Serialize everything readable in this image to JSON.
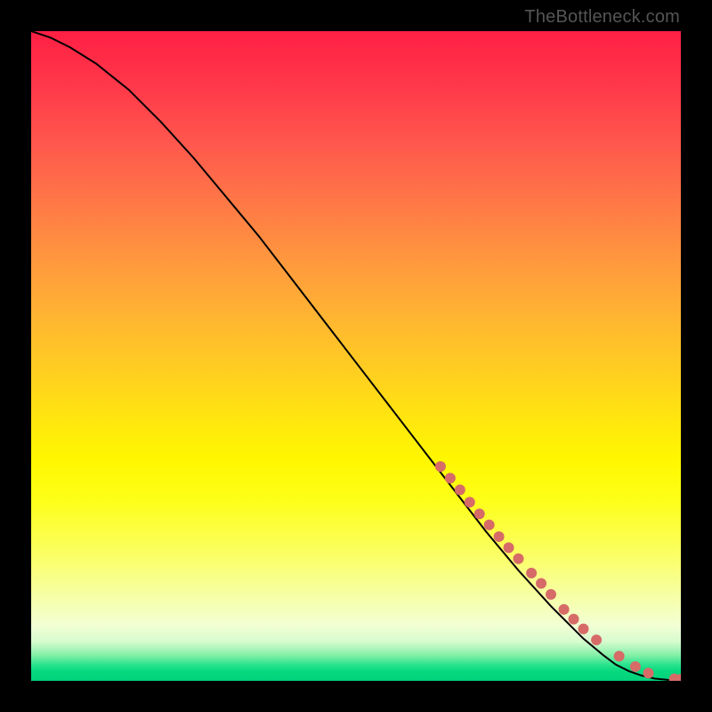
{
  "attribution": "TheBottleneck.com",
  "chart_data": {
    "type": "line",
    "title": "",
    "xlabel": "",
    "ylabel": "",
    "xlim": [
      0,
      100
    ],
    "ylim": [
      0,
      100
    ],
    "series": [
      {
        "name": "curve",
        "type": "line",
        "color": "#000000",
        "x": [
          0,
          3,
          6,
          10,
          15,
          20,
          25,
          30,
          35,
          40,
          45,
          50,
          55,
          60,
          65,
          70,
          75,
          80,
          85,
          88,
          90,
          92,
          94,
          96,
          98,
          100
        ],
        "values": [
          100,
          99,
          97.5,
          95,
          91,
          86,
          80.5,
          74.5,
          68.5,
          62,
          55.5,
          49,
          42.5,
          36,
          29.5,
          23,
          17,
          11.5,
          6.5,
          4,
          2.5,
          1.5,
          0.8,
          0.35,
          0.15,
          0.1
        ]
      },
      {
        "name": "markers",
        "type": "scatter",
        "color": "#d66b67",
        "radius": 6,
        "x": [
          63,
          64.5,
          66,
          67.5,
          69,
          70.5,
          72,
          73.5,
          75,
          77,
          78.5,
          80,
          82,
          83.5,
          85,
          87,
          90.5,
          93,
          95,
          99,
          100
        ],
        "values": [
          33,
          31.2,
          29.4,
          27.5,
          25.7,
          24,
          22.2,
          20.5,
          18.8,
          16.6,
          15,
          13.3,
          11,
          9.5,
          8,
          6.3,
          3.8,
          2.2,
          1.2,
          0.3,
          0.25
        ]
      }
    ]
  }
}
